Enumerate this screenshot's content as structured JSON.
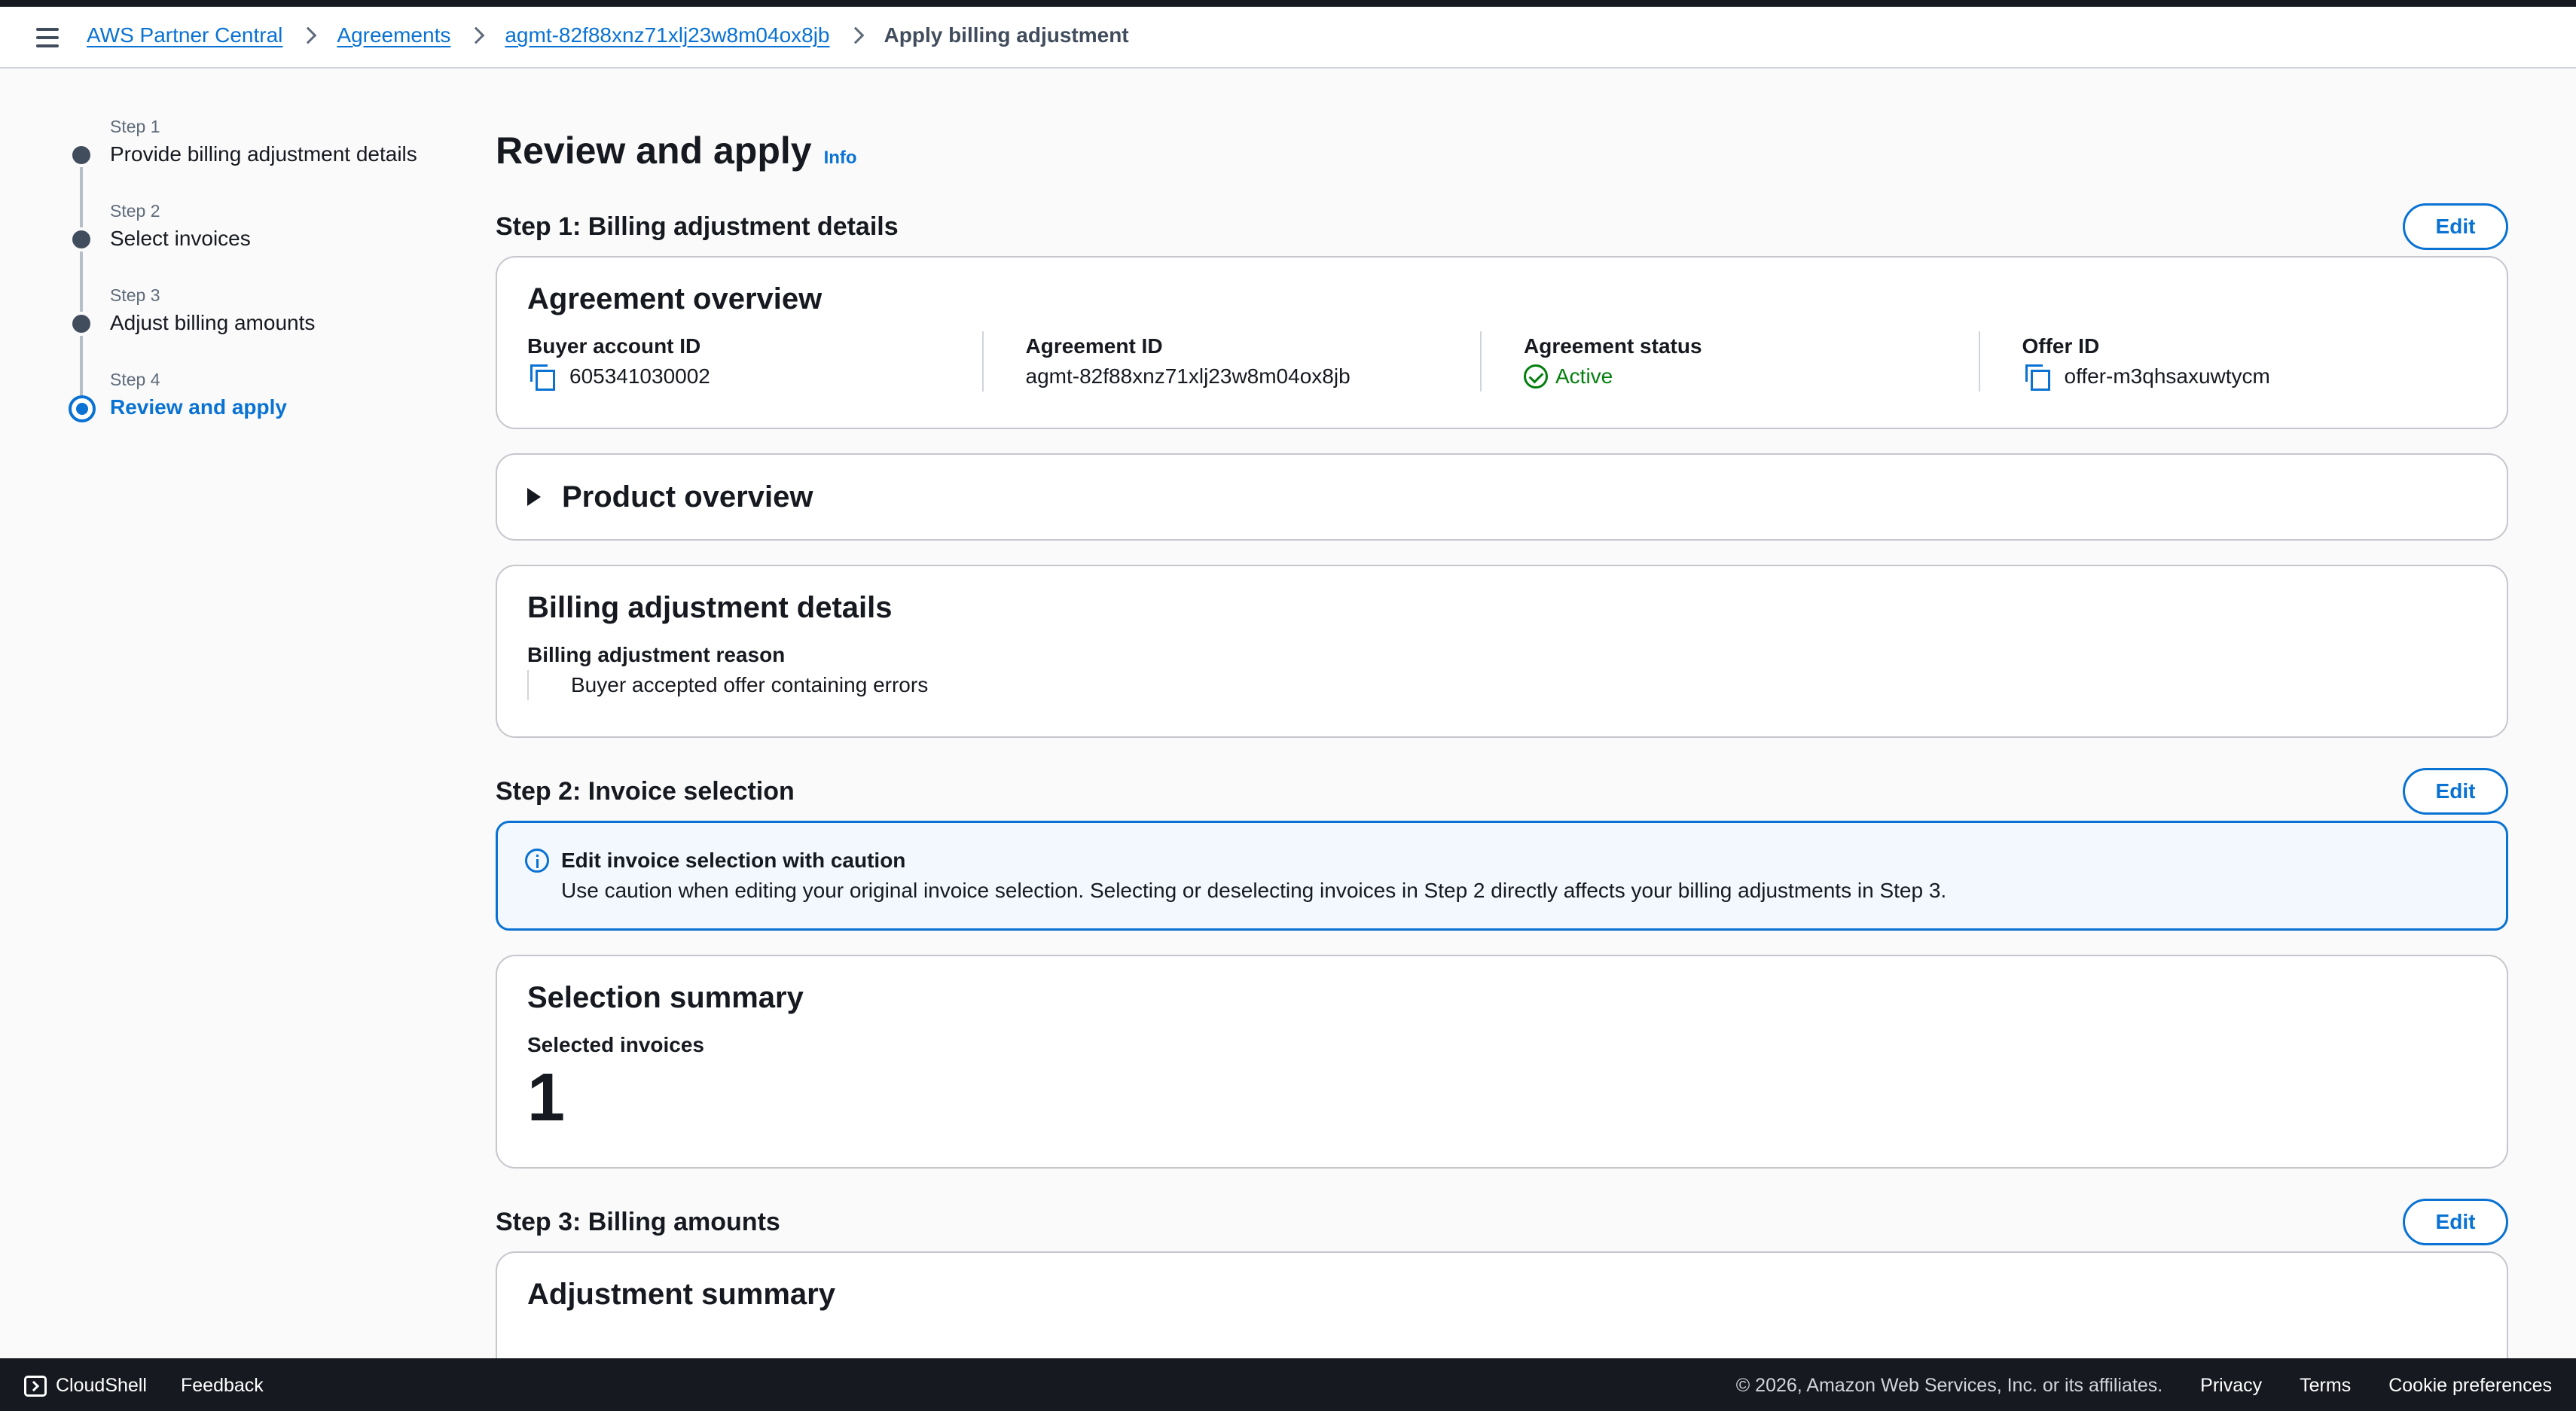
{
  "breadcrumb": {
    "items": [
      "AWS Partner Central",
      "Agreements",
      "agmt-82f88xnz71xlj23w8m04ox8jb"
    ],
    "current": "Apply billing adjustment"
  },
  "stepper": {
    "steps": [
      {
        "num": "Step 1",
        "name": "Provide billing adjustment details"
      },
      {
        "num": "Step 2",
        "name": "Select invoices"
      },
      {
        "num": "Step 3",
        "name": "Adjust billing amounts"
      },
      {
        "num": "Step 4",
        "name": "Review and apply"
      }
    ]
  },
  "page": {
    "title": "Review and apply",
    "info": "Info"
  },
  "section1": {
    "title": "Step 1: Billing adjustment details",
    "edit": "Edit",
    "overview": {
      "title": "Agreement overview",
      "buyer_label": "Buyer account ID",
      "buyer_value": "605341030002",
      "agreement_label": "Agreement ID",
      "agreement_value": "agmt-82f88xnz71xlj23w8m04ox8jb",
      "status_label": "Agreement status",
      "status_value": "Active",
      "offer_label": "Offer ID",
      "offer_value": "offer-m3qhsaxuwtycm"
    },
    "product_overview": "Product overview",
    "billing_details": {
      "title": "Billing adjustment details",
      "reason_label": "Billing adjustment reason",
      "reason_value": "Buyer accepted offer containing errors"
    }
  },
  "section2": {
    "title": "Step 2: Invoice selection",
    "edit": "Edit",
    "alert_title": "Edit invoice selection with caution",
    "alert_body": "Use caution when editing your original invoice selection. Selecting or deselecting invoices in Step 2 directly affects your billing adjustments in Step 3.",
    "summary_title": "Selection summary",
    "selected_label": "Selected invoices",
    "selected_value": "1"
  },
  "section3": {
    "title": "Step 3: Billing amounts",
    "edit": "Edit",
    "summary_title": "Adjustment summary"
  },
  "footer": {
    "cloudshell": "CloudShell",
    "feedback": "Feedback",
    "copyright": "© 2026, Amazon Web Services, Inc. or its affiliates.",
    "privacy": "Privacy",
    "terms": "Terms",
    "cookies": "Cookie preferences"
  },
  "colors": {
    "link": "#0972d3",
    "success": "#037f0c",
    "footer_bg": "#16191f"
  }
}
